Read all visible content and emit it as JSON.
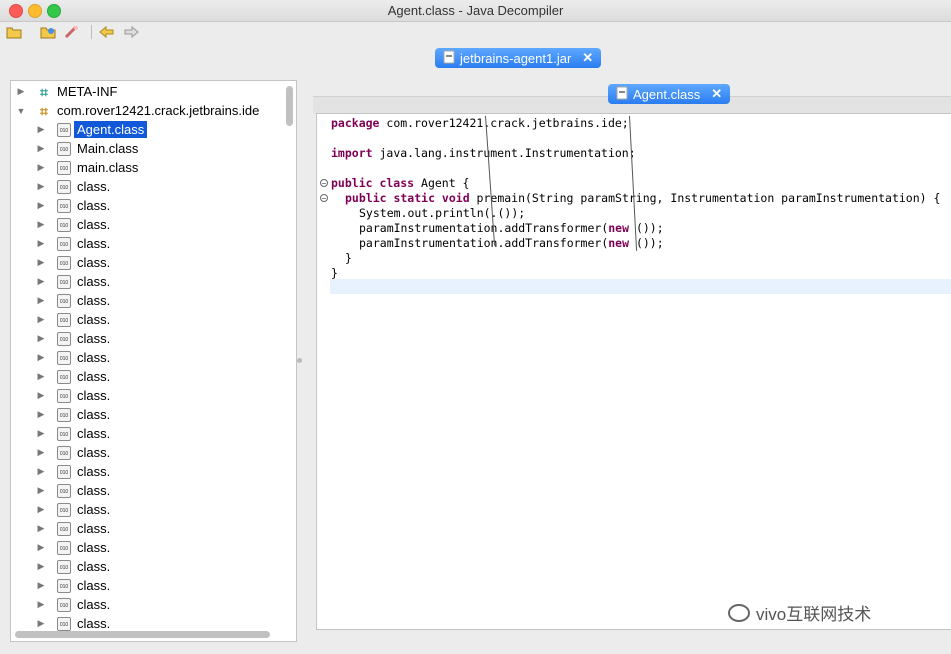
{
  "window": {
    "title": "Agent.class - Java Decompiler"
  },
  "toolbar": {
    "icons": [
      "open-file-icon",
      "open-folder-icon",
      "search-icon",
      "back-arrow-icon",
      "forward-arrow-icon"
    ]
  },
  "jar_tab": {
    "label": "jetbrains-agent1.jar",
    "close": "✕"
  },
  "tree": {
    "meta_inf": "META-INF",
    "package": "com.rover12421.crack.jetbrains.ide",
    "items": [
      "Agent.class",
      "Main.class",
      "main.class",
      "class.",
      "class.",
      "class.",
      "class.",
      "class.",
      "class.",
      "class.",
      "class.",
      "class.",
      "class.",
      "class.",
      "class.",
      "class.",
      "class.",
      "class.",
      "class.",
      "class.",
      "class.",
      "class.",
      "class.",
      "class.",
      "class.",
      "class.",
      "class."
    ],
    "selected": "Agent.class"
  },
  "editor_tab": {
    "label": "Agent.class",
    "close": "✕"
  },
  "code": {
    "l1_kw": "package",
    "l1": " com.rover12421.crack.jetbrains.ide;",
    "l3_kw": "import",
    "l3": " java.lang.instrument.Instrumentation;",
    "l5_kw": "public class",
    "l5": " Agent {",
    "l6_kw": "public static void",
    "l6": " premain(String paramString, Instrumentation paramInstrumentation) {",
    "l7": "System.out.println(.());",
    "l8a": "paramInstrumentation.addTransformer(",
    "l8_kw": "new",
    "l8b": " ());",
    "l9a": "paramInstrumentation.addTransformer(",
    "l9_kw": "new",
    "l9b": " ());",
    "l10": "}",
    "l11": "}"
  },
  "watermark": {
    "text": "vivo互联网技术"
  }
}
